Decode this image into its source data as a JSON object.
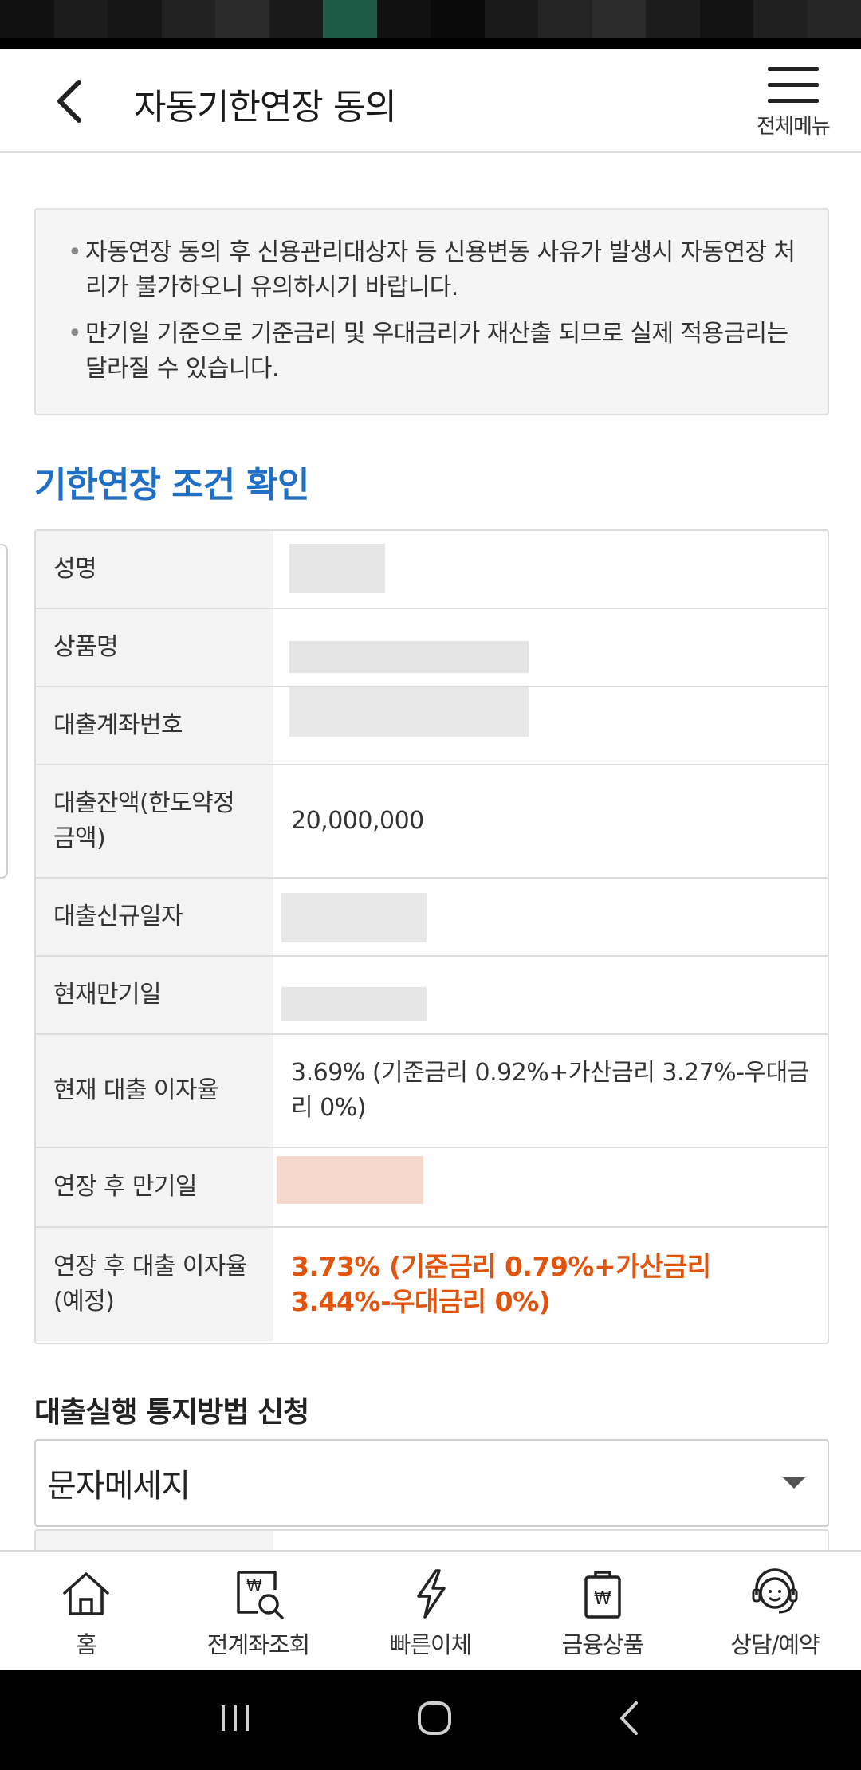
{
  "header": {
    "title": "자동기한연장 동의",
    "menu_label": "전체메뉴"
  },
  "notice": {
    "items": [
      "자동연장 동의 후 신용관리대상자 등 신용변동 사유가 발생시 자동연장 처리가 불가하오니 유의하시기 바랍니다.",
      "만기일 기준으로 기준금리 및 우대금리가 재산출 되므로 실제 적용금리는 달라질 수 있습니다."
    ]
  },
  "section_title": "기한연장 조건 확인",
  "table": {
    "rows": [
      {
        "label": "성명",
        "value": ""
      },
      {
        "label": "상품명",
        "value": ""
      },
      {
        "label": "대출계좌번호",
        "value": ""
      },
      {
        "label": "대출잔액(한도약정금액)",
        "value": "20,000,000"
      },
      {
        "label": "대출신규일자",
        "value": ""
      },
      {
        "label": "현재만기일",
        "value": ""
      },
      {
        "label": "현재 대출 이자율",
        "value": "3.69% (기준금리 0.92%+가산금리 3.27%-우대금리 0%)"
      },
      {
        "label": "연장 후 만기일",
        "value": ""
      },
      {
        "label": "연장 후 대출 이자율(예정)",
        "value": "3.73% (기준금리 0.79%+가산금리 3.44%-우대금리 0%)"
      }
    ]
  },
  "notify": {
    "title": "대출실행 통지방법 신청",
    "selected": "문자메세지"
  },
  "tabbar": {
    "items": [
      {
        "label": "홈",
        "icon": "home-icon"
      },
      {
        "label": "전계좌조회",
        "icon": "account-search-icon"
      },
      {
        "label": "빠른이체",
        "icon": "lightning-icon"
      },
      {
        "label": "금융상품",
        "icon": "financial-product-icon"
      },
      {
        "label": "상담/예약",
        "icon": "support-agent-icon"
      }
    ]
  },
  "colors": {
    "accent_blue": "#1f6fc6",
    "highlight_orange": "#e1540e"
  }
}
